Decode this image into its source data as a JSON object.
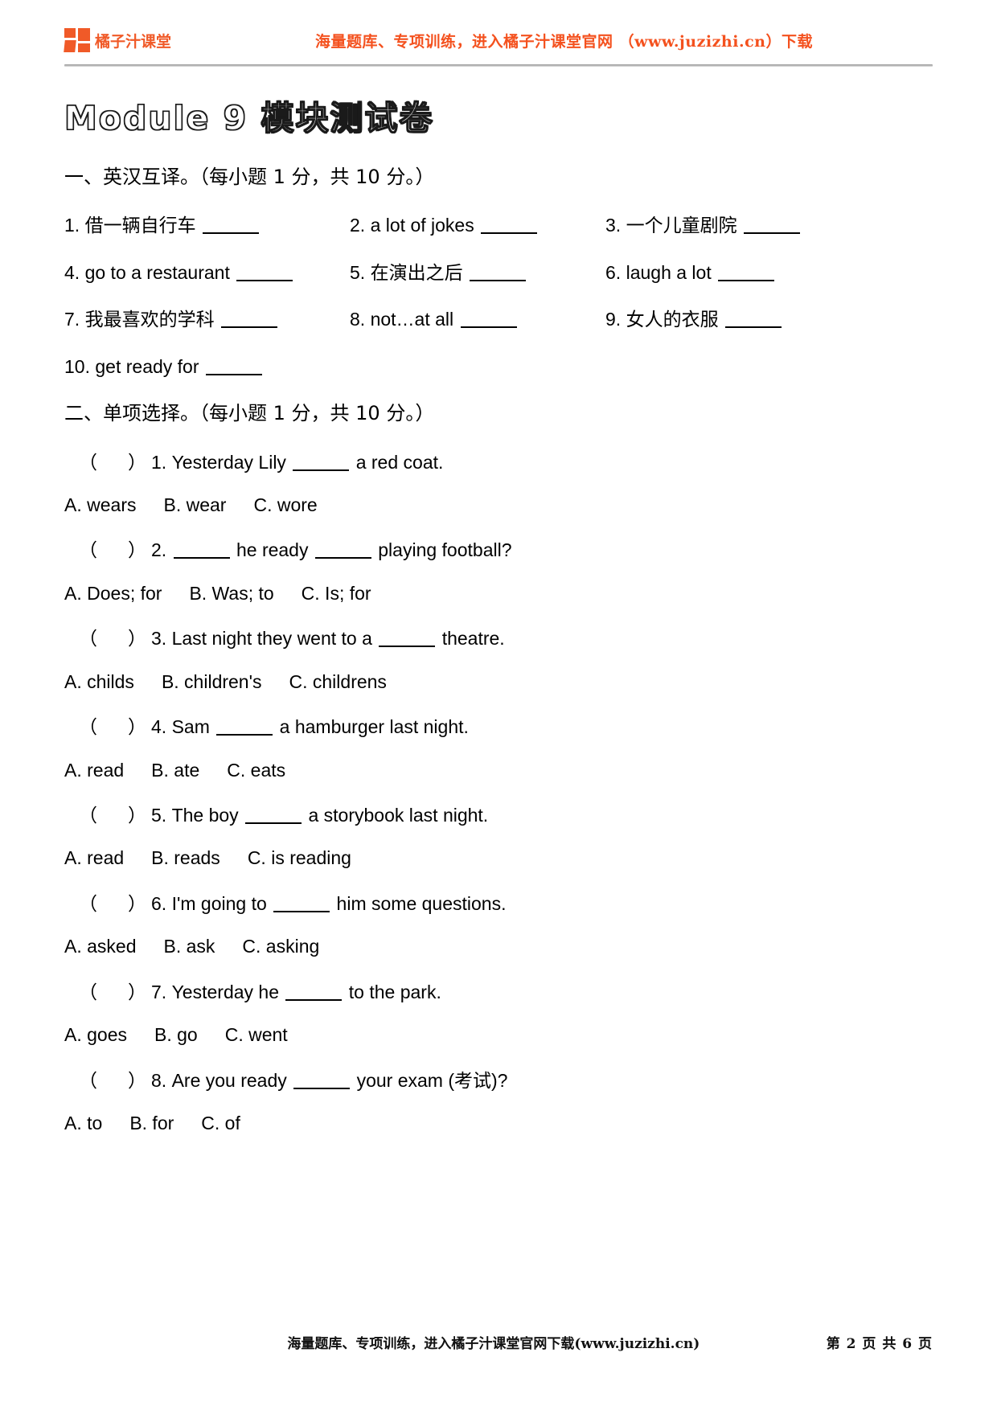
{
  "header": {
    "logo_text": "橘子汁课堂",
    "logo_color": "#F05A28",
    "promo": "海量题库、专项训练，进入橘子汁课堂官网 （www.juzizhi.cn）下载"
  },
  "title": "Module  9 模块测试卷",
  "section1": {
    "heading": "一、英汉互译。（每小题 1 分，共 10 分。）",
    "rows": [
      [
        {
          "num": "1.",
          "text": "借一辆自行车"
        },
        {
          "num": "2.",
          "text": "a lot of jokes"
        },
        {
          "num": "3.",
          "text": "一个儿童剧院"
        }
      ],
      [
        {
          "num": "4.",
          "text": "go to a restaurant"
        },
        {
          "num": "5.",
          "text": "在演出之后"
        },
        {
          "num": "6.",
          "text": "laugh a lot"
        }
      ],
      [
        {
          "num": "7.",
          "text": "我最喜欢的学科"
        },
        {
          "num": "8.",
          "text": "not…at all"
        },
        {
          "num": "9.",
          "text": "女人的衣服"
        }
      ]
    ],
    "last_item": {
      "num": "10.",
      "text": "get ready for"
    }
  },
  "section2": {
    "heading": "二、单项选择。（每小题 1 分，共 10 分。）",
    "questions": [
      {
        "num": "1.",
        "before": "Yesterday Lily",
        "after": "a red coat.",
        "options": [
          "A. wears",
          "B. wear",
          "C. wore"
        ]
      },
      {
        "num": "2.",
        "before": "",
        "mid": "he ready",
        "after": "playing football?",
        "options": [
          "A. Does; for",
          "B. Was; to",
          "C. Is; for"
        ]
      },
      {
        "num": "3.",
        "before": "Last night they went to a",
        "after": "theatre.",
        "options": [
          "A. childs",
          "B. children's",
          "C. childrens"
        ]
      },
      {
        "num": "4.",
        "before": "Sam",
        "after": "a hamburger last night.",
        "options": [
          "A. read",
          "B. ate",
          "C. eats"
        ]
      },
      {
        "num": "5.",
        "before": "The boy",
        "after": "a storybook last night.",
        "options": [
          "A. read",
          "B. reads",
          "C. is reading"
        ]
      },
      {
        "num": "6.",
        "before": "I'm going to",
        "after": "him some questions.",
        "options": [
          "A. asked",
          "B. ask",
          "C. asking"
        ]
      },
      {
        "num": "7.",
        "before": "Yesterday he",
        "after": "to the park.",
        "options": [
          "A. goes",
          "B. go",
          "C. went"
        ]
      },
      {
        "num": "8.",
        "before": "Are you ready",
        "after": "your exam (考试)?",
        "options": [
          "A. to",
          "B. for",
          "C. of"
        ]
      }
    ]
  },
  "footer": {
    "note": "海量题库、专项训练，进入橘子汁课堂官网下载(www.juzizhi.cn)",
    "page": "第 2 页 共 6 页"
  }
}
